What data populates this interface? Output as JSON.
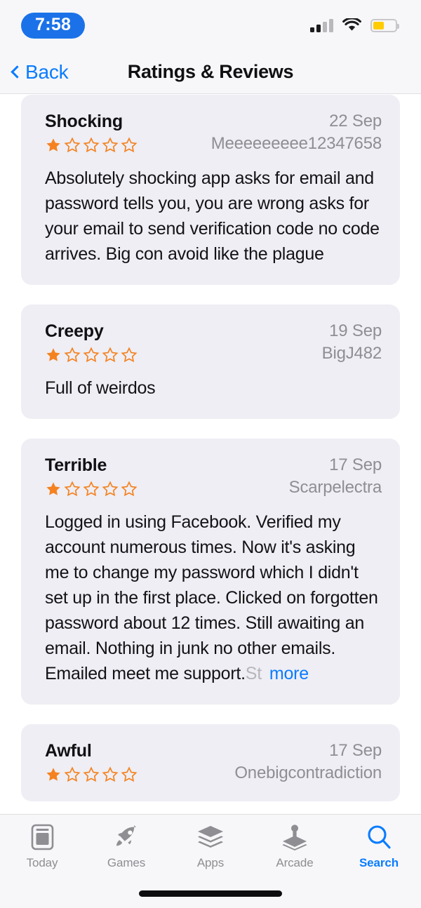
{
  "status_bar": {
    "time": "7:58",
    "signal_bars_total": 4,
    "signal_bars_filled": 2,
    "wifi": "wifi-icon",
    "battery_percent": 50,
    "battery_color": "#ffcc00",
    "time_pill_color": "#1b72e8"
  },
  "nav": {
    "back_label": "Back",
    "title": "Ratings & Reviews"
  },
  "theme": {
    "accent": "#0a7cff",
    "star_color": "#f58220",
    "card_bg": "#eeeef4",
    "muted_text": "#8e8e93"
  },
  "reviews": [
    {
      "title": "Shocking",
      "date": "22 Sep",
      "user": "Meeeeeeeee12347658",
      "rating": 1,
      "body": "Absolutely shocking app asks for email and password tells you, you are wrong asks for your email to send verification code no code arrives. Big con avoid like the plague",
      "truncated": false,
      "tail": "",
      "more_label": ""
    },
    {
      "title": "Creepy",
      "date": "19 Sep",
      "user": "BigJ482",
      "rating": 1,
      "body": "Full of weirdos",
      "truncated": false,
      "tail": "",
      "more_label": ""
    },
    {
      "title": "Terrible",
      "date": "17 Sep",
      "user": "Scarpelectra",
      "rating": 1,
      "body": "Logged in using Facebook. Verified my account numerous times. Now it's asking me to change my password which I didn't set up in the first place. Clicked on forgotten password about 12 times. Still awaiting an email. Nothing in junk no other emails. Emailed meet me support.",
      "truncated": true,
      "tail": "St",
      "more_label": "more"
    },
    {
      "title": "Awful",
      "date": "17 Sep",
      "user": "Onebigcontradiction",
      "rating": 1,
      "body": "",
      "truncated": false,
      "tail": "",
      "more_label": ""
    }
  ],
  "tab_bar": {
    "items": [
      {
        "label": "Today",
        "icon": "today-icon",
        "active": false
      },
      {
        "label": "Games",
        "icon": "rocket-icon",
        "active": false
      },
      {
        "label": "Apps",
        "icon": "layers-icon",
        "active": false
      },
      {
        "label": "Arcade",
        "icon": "joystick-icon",
        "active": false
      },
      {
        "label": "Search",
        "icon": "search-icon",
        "active": true
      }
    ]
  }
}
